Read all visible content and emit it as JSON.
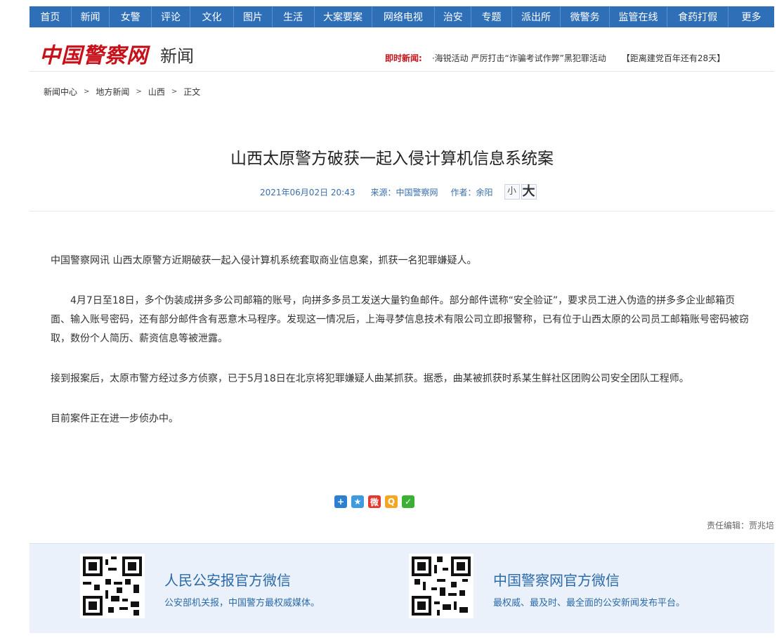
{
  "nav": [
    "首页",
    "新闻",
    "女警",
    "评论",
    "文化",
    "图片",
    "生活",
    "大案要案",
    "网络电视",
    "治安",
    "专题",
    "派出所",
    "微警务",
    "监管在线",
    "食药打假",
    "更多"
  ],
  "header": {
    "logo": "中国警察网",
    "section": "新闻",
    "ticker_label": "即时新闻:",
    "ticker_text": "·海锐活动   严厉打击“诈骗考试作弊”黑犯罪活动",
    "countdown": "【距离建党百年还有28天】"
  },
  "breadcrumb": [
    "新闻中心",
    "地方新闻",
    "山西",
    "正文"
  ],
  "article": {
    "title": "山西太原警方破获一起入侵计算机信息系统案",
    "date": "2021年06月02日 20:43",
    "source": "来源：中国警察网",
    "author": "作者：余阳",
    "font_small": "小",
    "font_large": "大",
    "paragraphs": [
      "中国警察网讯 山西太原警方近期破获一起入侵计算机系统套取商业信息案，抓获一名犯罪嫌疑人。",
      "4月7日至18日，多个伪装成拼多多公司邮箱的账号，向拼多多员工发送大量钓鱼邮件。部分邮件谎称“安全验证”，要求员工进入伪造的拼多多企业邮箱页面、输入账号密码，还有部分邮件含有恶意木马程序。发现这一情况后，上海寻梦信息技术有限公司立即报警称，已有位于山西太原的公司员工邮箱账号密码被窃取，数份个人简历、薪资信息等被泄露。",
      "接到报案后，太原市警方经过多方侦察，已于5月18日在北京将犯罪嫌疑人曲某抓获。据悉，曲某被抓获时系某生鲜社区团购公司安全团队工程师。",
      "目前案件正在进一步侦办中。"
    ],
    "editor": "责任编辑：贾兆培"
  },
  "share_icons": [
    "share-plus-icon",
    "qzone-icon",
    "weibo-icon",
    "qq-icon",
    "wechat-icon"
  ],
  "footer": {
    "left": {
      "title": "人民公安报官方微信",
      "sub": "公安部机关报，中国警方最权威媒体。"
    },
    "right": {
      "title": "中国警察网官方微信",
      "sub": "最权威、最及时、最全面的公安新闻发布平台。"
    }
  }
}
